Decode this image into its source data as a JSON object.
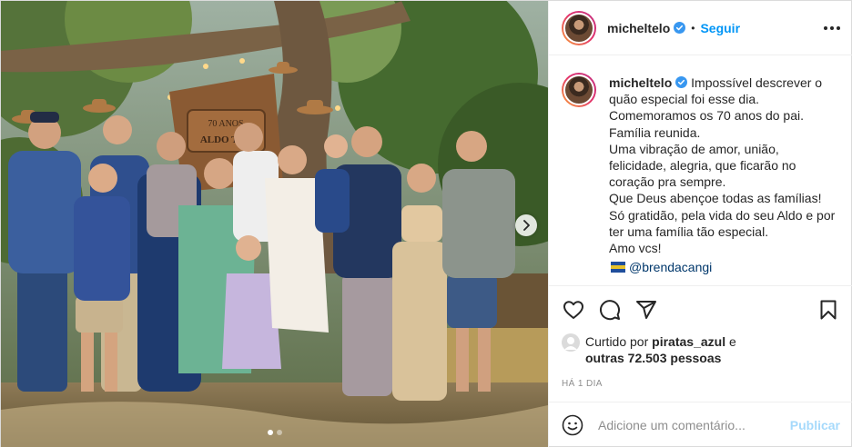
{
  "post": {
    "username": "micheltelo",
    "verified": true,
    "follow_label": "Seguir",
    "caption": "Impossível descrever o quão especial foi esse dia.\nComemoramos os 70 anos do pai.\nFamília reunida.\nUma vibração de amor, união, felicidade, alegria, que ficarão no coração pra sempre.\nQue Deus abençoe todas as famílias!\nSó gratidão, pela vida do seu Aldo e por ter uma família tão especial.\nAmo vcs!",
    "mention": "@brendacangi",
    "photo": {
      "sign_line1": "70 ANOS",
      "sign_line2": "ALDO TEL"
    },
    "carousel": {
      "total": 2,
      "active": 1
    },
    "likes": {
      "prefix": "Curtido por",
      "liked_by": "piratas_azul",
      "and_label": "e",
      "others": "outras 72.503 pessoas"
    },
    "timestamp": "HÁ 1 DIA",
    "comment": {
      "placeholder": "Adicione um comentário...",
      "publish_label": "Publicar"
    },
    "icons": {
      "like": "heart-icon",
      "comment": "comment-icon",
      "share": "share-icon",
      "save": "bookmark-icon",
      "more": "more-options-icon",
      "emoji": "emoji-icon",
      "next": "chevron-right-icon"
    },
    "colors": {
      "accent": "#0095f6",
      "verified": "#3897f0",
      "text": "#262626",
      "muted": "#8e8e8e"
    }
  }
}
